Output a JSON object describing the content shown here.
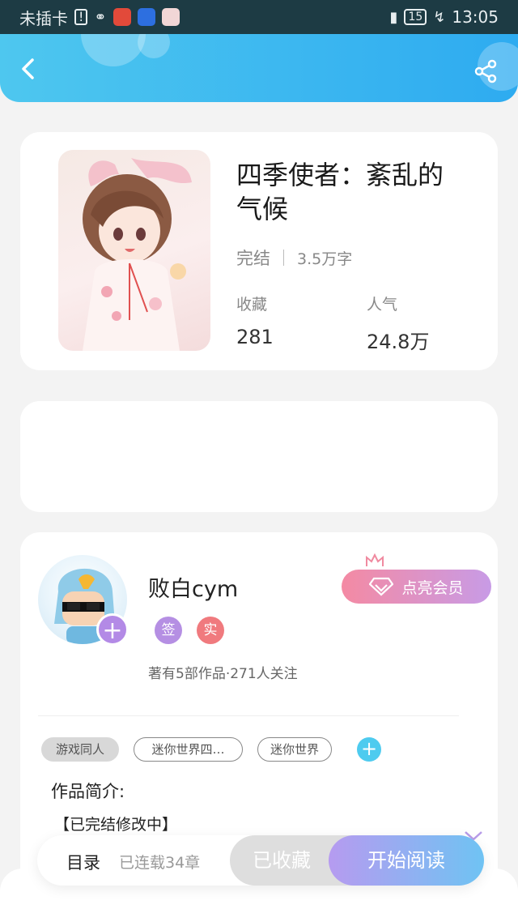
{
  "status_bar": {
    "carrier": "未插卡",
    "battery": "15",
    "time": "13:05"
  },
  "header": {
    "accent_color": "#2eabf0"
  },
  "book": {
    "title_line1": "四季使者：紊乱的",
    "title_line2": "气候",
    "status": "完结",
    "word_count": "3.5万字",
    "favorites_label": "收藏",
    "favorites_value": "281",
    "popularity_label": "人气",
    "popularity_value": "24.8万"
  },
  "author": {
    "name": "败白cym",
    "badge_sign": "签",
    "badge_real": "实",
    "stats": "著有5部作品·271人关注",
    "vip_button": "点亮会员"
  },
  "tags": [
    "游戏同人",
    "迷你世界四…",
    "迷你世界"
  ],
  "intro": {
    "heading": "作品简介:",
    "text": "【已完结修改中】"
  },
  "bottom_bar": {
    "toc": "目录",
    "chapters": "已连载34章",
    "collected": "已收藏",
    "start_reading": "开始阅读"
  }
}
